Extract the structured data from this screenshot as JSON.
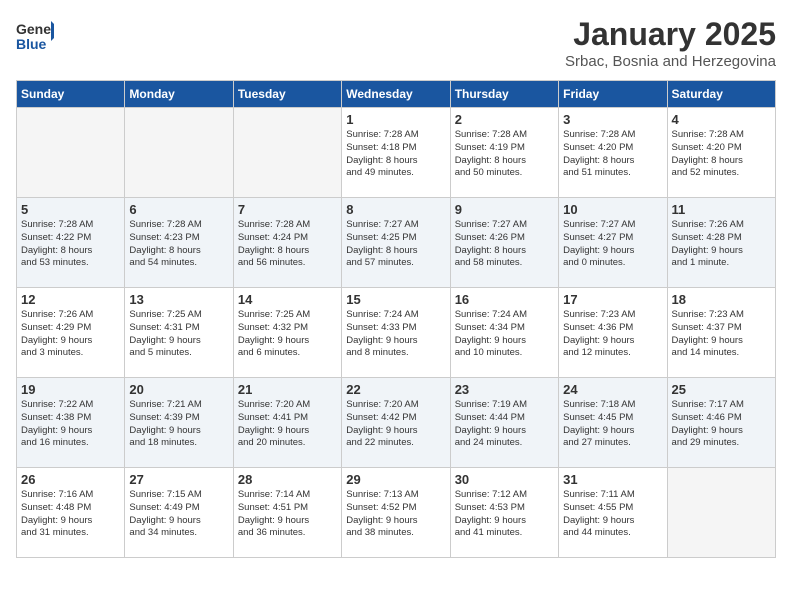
{
  "header": {
    "logo_general": "General",
    "logo_blue": "Blue",
    "month": "January 2025",
    "location": "Srbac, Bosnia and Herzegovina"
  },
  "days_of_week": [
    "Sunday",
    "Monday",
    "Tuesday",
    "Wednesday",
    "Thursday",
    "Friday",
    "Saturday"
  ],
  "weeks": [
    [
      {
        "num": "",
        "info": "",
        "empty": true
      },
      {
        "num": "",
        "info": "",
        "empty": true
      },
      {
        "num": "",
        "info": "",
        "empty": true
      },
      {
        "num": "1",
        "info": "Sunrise: 7:28 AM\nSunset: 4:18 PM\nDaylight: 8 hours\nand 49 minutes."
      },
      {
        "num": "2",
        "info": "Sunrise: 7:28 AM\nSunset: 4:19 PM\nDaylight: 8 hours\nand 50 minutes."
      },
      {
        "num": "3",
        "info": "Sunrise: 7:28 AM\nSunset: 4:20 PM\nDaylight: 8 hours\nand 51 minutes."
      },
      {
        "num": "4",
        "info": "Sunrise: 7:28 AM\nSunset: 4:20 PM\nDaylight: 8 hours\nand 52 minutes."
      }
    ],
    [
      {
        "num": "5",
        "info": "Sunrise: 7:28 AM\nSunset: 4:22 PM\nDaylight: 8 hours\nand 53 minutes."
      },
      {
        "num": "6",
        "info": "Sunrise: 7:28 AM\nSunset: 4:23 PM\nDaylight: 8 hours\nand 54 minutes."
      },
      {
        "num": "7",
        "info": "Sunrise: 7:28 AM\nSunset: 4:24 PM\nDaylight: 8 hours\nand 56 minutes."
      },
      {
        "num": "8",
        "info": "Sunrise: 7:27 AM\nSunset: 4:25 PM\nDaylight: 8 hours\nand 57 minutes."
      },
      {
        "num": "9",
        "info": "Sunrise: 7:27 AM\nSunset: 4:26 PM\nDaylight: 8 hours\nand 58 minutes."
      },
      {
        "num": "10",
        "info": "Sunrise: 7:27 AM\nSunset: 4:27 PM\nDaylight: 9 hours\nand 0 minutes."
      },
      {
        "num": "11",
        "info": "Sunrise: 7:26 AM\nSunset: 4:28 PM\nDaylight: 9 hours\nand 1 minute."
      }
    ],
    [
      {
        "num": "12",
        "info": "Sunrise: 7:26 AM\nSunset: 4:29 PM\nDaylight: 9 hours\nand 3 minutes."
      },
      {
        "num": "13",
        "info": "Sunrise: 7:25 AM\nSunset: 4:31 PM\nDaylight: 9 hours\nand 5 minutes."
      },
      {
        "num": "14",
        "info": "Sunrise: 7:25 AM\nSunset: 4:32 PM\nDaylight: 9 hours\nand 6 minutes."
      },
      {
        "num": "15",
        "info": "Sunrise: 7:24 AM\nSunset: 4:33 PM\nDaylight: 9 hours\nand 8 minutes."
      },
      {
        "num": "16",
        "info": "Sunrise: 7:24 AM\nSunset: 4:34 PM\nDaylight: 9 hours\nand 10 minutes."
      },
      {
        "num": "17",
        "info": "Sunrise: 7:23 AM\nSunset: 4:36 PM\nDaylight: 9 hours\nand 12 minutes."
      },
      {
        "num": "18",
        "info": "Sunrise: 7:23 AM\nSunset: 4:37 PM\nDaylight: 9 hours\nand 14 minutes."
      }
    ],
    [
      {
        "num": "19",
        "info": "Sunrise: 7:22 AM\nSunset: 4:38 PM\nDaylight: 9 hours\nand 16 minutes."
      },
      {
        "num": "20",
        "info": "Sunrise: 7:21 AM\nSunset: 4:39 PM\nDaylight: 9 hours\nand 18 minutes."
      },
      {
        "num": "21",
        "info": "Sunrise: 7:20 AM\nSunset: 4:41 PM\nDaylight: 9 hours\nand 20 minutes."
      },
      {
        "num": "22",
        "info": "Sunrise: 7:20 AM\nSunset: 4:42 PM\nDaylight: 9 hours\nand 22 minutes."
      },
      {
        "num": "23",
        "info": "Sunrise: 7:19 AM\nSunset: 4:44 PM\nDaylight: 9 hours\nand 24 minutes."
      },
      {
        "num": "24",
        "info": "Sunrise: 7:18 AM\nSunset: 4:45 PM\nDaylight: 9 hours\nand 27 minutes."
      },
      {
        "num": "25",
        "info": "Sunrise: 7:17 AM\nSunset: 4:46 PM\nDaylight: 9 hours\nand 29 minutes."
      }
    ],
    [
      {
        "num": "26",
        "info": "Sunrise: 7:16 AM\nSunset: 4:48 PM\nDaylight: 9 hours\nand 31 minutes."
      },
      {
        "num": "27",
        "info": "Sunrise: 7:15 AM\nSunset: 4:49 PM\nDaylight: 9 hours\nand 34 minutes."
      },
      {
        "num": "28",
        "info": "Sunrise: 7:14 AM\nSunset: 4:51 PM\nDaylight: 9 hours\nand 36 minutes."
      },
      {
        "num": "29",
        "info": "Sunrise: 7:13 AM\nSunset: 4:52 PM\nDaylight: 9 hours\nand 38 minutes."
      },
      {
        "num": "30",
        "info": "Sunrise: 7:12 AM\nSunset: 4:53 PM\nDaylight: 9 hours\nand 41 minutes."
      },
      {
        "num": "31",
        "info": "Sunrise: 7:11 AM\nSunset: 4:55 PM\nDaylight: 9 hours\nand 44 minutes."
      },
      {
        "num": "",
        "info": "",
        "empty": true
      }
    ]
  ]
}
